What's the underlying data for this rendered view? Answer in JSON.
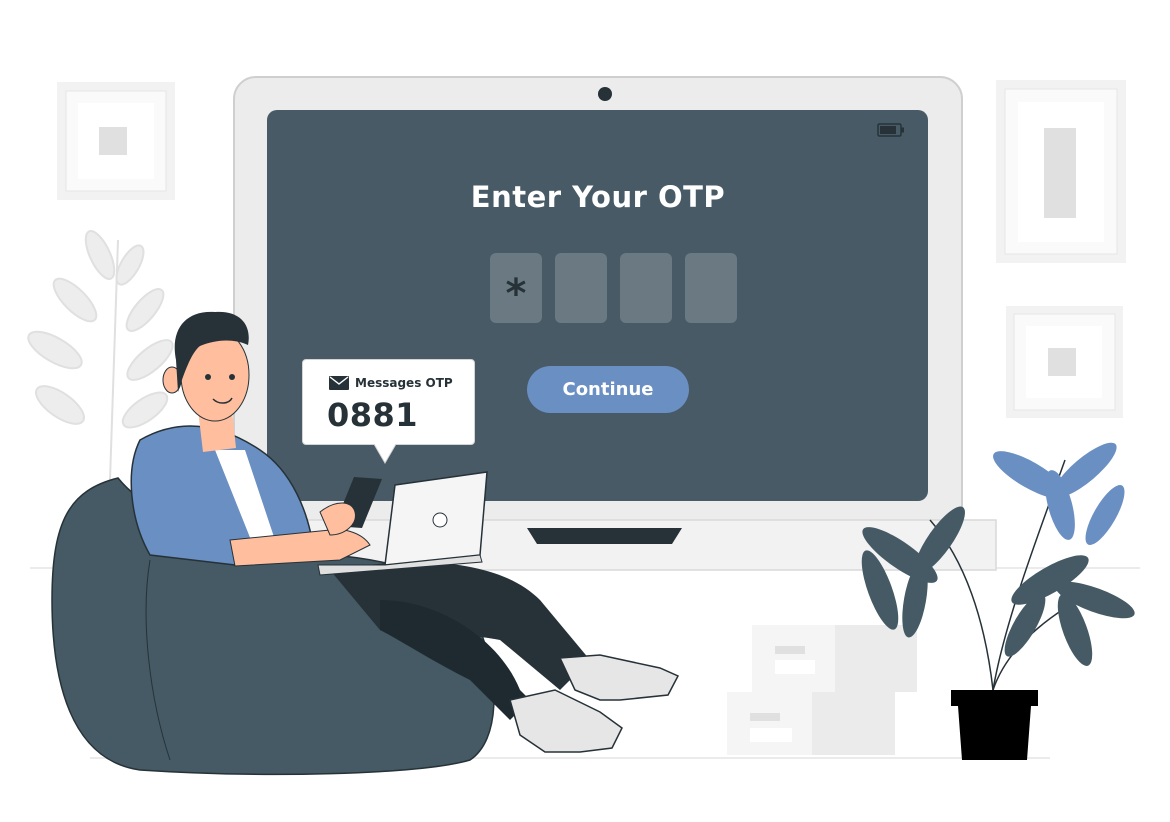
{
  "screen": {
    "title": "Enter Your OTP",
    "otp_digits": [
      "*",
      "",
      "",
      ""
    ],
    "continue_label": "Continue"
  },
  "message": {
    "label": "Messages OTP",
    "code": "0881"
  },
  "colors": {
    "screen_bg": "#475a66",
    "laptop_frame": "#e4e4e4",
    "button": "#6a8fc3",
    "otp_box": "#6b7a82",
    "dark_text": "#263238",
    "shirt": "#6a8fc3",
    "plant": "#455a64",
    "plant_accent": "#6a8fc3",
    "chair": "#455a64"
  },
  "icons": [
    "battery-icon",
    "camera-icon",
    "mail-icon",
    "laptop-logo-icon"
  ]
}
